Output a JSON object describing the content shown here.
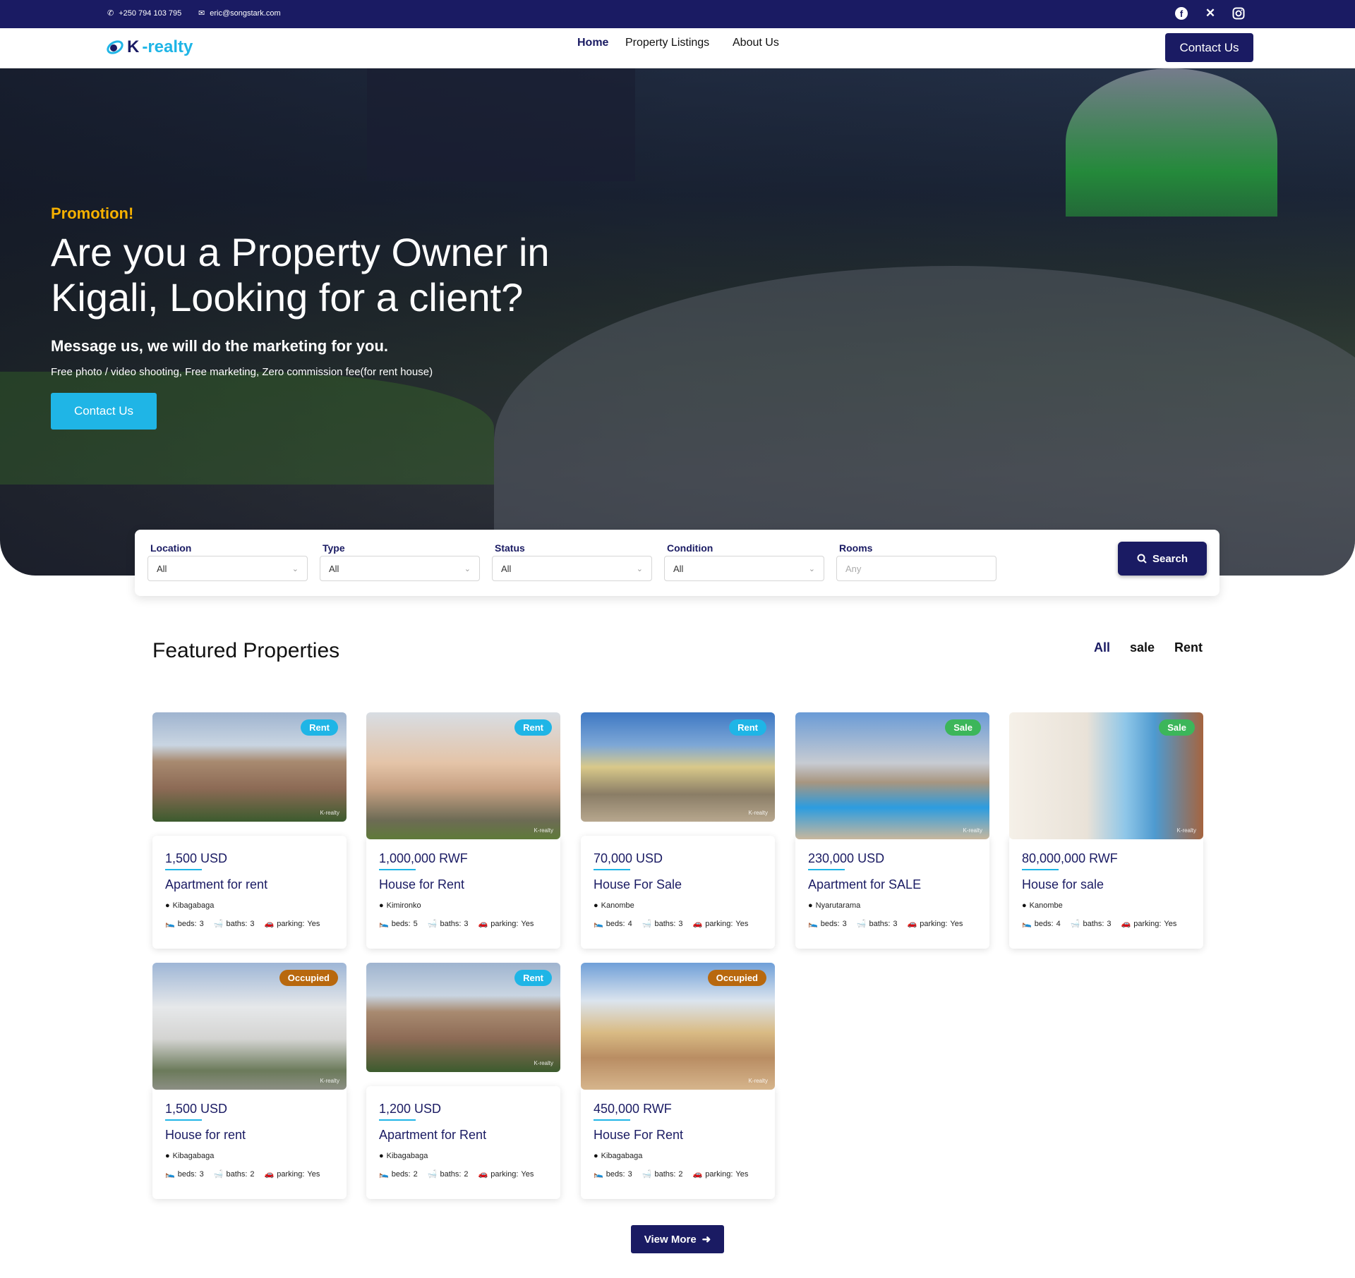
{
  "topbar": {
    "phone": "+250 794 103 795",
    "email": "eric@songstark.com",
    "social": [
      "facebook-icon",
      "x-icon",
      "instagram-icon"
    ]
  },
  "nav": {
    "logo_k": "K",
    "logo_rest": "-realty",
    "links": [
      "Home",
      "Property Listings",
      "About Us"
    ],
    "contact_label": "Contact Us"
  },
  "hero": {
    "promo": "Promotion!",
    "heading": "Are you a Property Owner in Kigali, Looking for a client?",
    "subheading": "Message us, we will do the marketing for you.",
    "description": "Free photo / video shooting, Free marketing, Zero commission fee(for rent house)",
    "button": "Contact Us"
  },
  "search": {
    "fields": [
      {
        "label": "Location",
        "value": "All"
      },
      {
        "label": "Type",
        "value": "All"
      },
      {
        "label": "Status",
        "value": "All"
      },
      {
        "label": "Condition",
        "value": "All"
      },
      {
        "label": "Rooms",
        "placeholder": "Any"
      }
    ],
    "button": "Search"
  },
  "featured": {
    "title": "Featured Properties",
    "filters": [
      "All",
      "sale",
      "Rent"
    ]
  },
  "labels": {
    "beds": "beds:",
    "baths": "baths:",
    "parking": "parking:"
  },
  "watermark": "K-realty",
  "colors": {
    "rent": "#1fb5e6",
    "sale": "#3cb65a",
    "occupied": "#b8680e",
    "brand": "#1a1b63"
  },
  "cards": [
    {
      "badge": "Rent",
      "price": "1,500 USD",
      "title": "Apartment for rent",
      "location": "Kibagabaga",
      "beds": "3",
      "baths": "3",
      "parking": "Yes"
    },
    {
      "badge": "Rent",
      "price": "1,000,000 RWF",
      "title": "House for Rent",
      "location": "Kimironko",
      "beds": "5",
      "baths": "3",
      "parking": "Yes"
    },
    {
      "badge": "Rent",
      "price": "70,000 USD",
      "title": "House For Sale",
      "location": "Kanombe",
      "beds": "4",
      "baths": "3",
      "parking": "Yes"
    },
    {
      "badge": "Sale",
      "price": "230,000 USD",
      "title": "Apartment for SALE",
      "location": "Nyarutarama",
      "beds": "3",
      "baths": "3",
      "parking": "Yes"
    },
    {
      "badge": "Sale",
      "price": "80,000,000 RWF",
      "title": "House for sale",
      "location": "Kanombe",
      "beds": "4",
      "baths": "3",
      "parking": "Yes"
    },
    {
      "badge": "Occupied",
      "price": "1,500 USD",
      "title": "House for rent",
      "location": "Kibagabaga",
      "beds": "3",
      "baths": "2",
      "parking": "Yes"
    },
    {
      "badge": "Rent",
      "price": "1,200 USD",
      "title": "Apartment for Rent",
      "location": "Kibagabaga",
      "beds": "2",
      "baths": "2",
      "parking": "Yes"
    },
    {
      "badge": "Occupied",
      "price": "450,000 RWF",
      "title": "House For Rent",
      "location": "Kibagabaga",
      "beds": "3",
      "baths": "2",
      "parking": "Yes"
    }
  ],
  "view_more": "View More"
}
